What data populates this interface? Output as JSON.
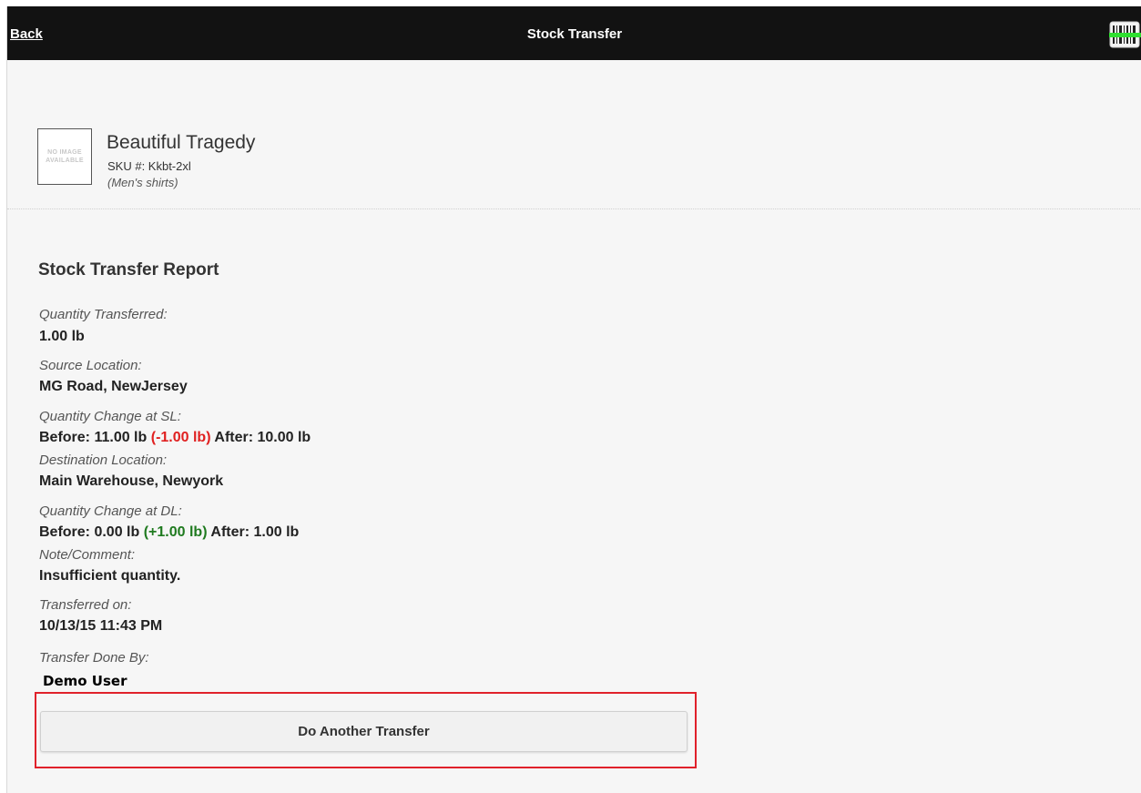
{
  "header": {
    "back_label": "Back",
    "title": "Stock Transfer",
    "barcode_icon": "barcode-scanner-icon"
  },
  "product": {
    "image_placeholder_line1": "NO IMAGE",
    "image_placeholder_line2": "AVAILABLE",
    "name": "Beautiful Tragedy",
    "sku": "SKU #: Kkbt-2xl",
    "category": "(Men's shirts)"
  },
  "report": {
    "title": "Stock Transfer Report",
    "qty_transferred_label": "Quantity Transferred:",
    "qty_transferred_value": "1.00 lb",
    "source_label": "Source Location:",
    "source_value": "MG Road, NewJersey",
    "change_sl_label": "Quantity Change at SL:",
    "change_sl_before": "Before: 11.00 lb",
    "change_sl_delta": "(-1.00 lb)",
    "change_sl_after": "After: 10.00 lb",
    "destination_label": "Destination Location:",
    "destination_value": "Main Warehouse, Newyork",
    "change_dl_label": "Quantity Change at DL:",
    "change_dl_before": "Before: 0.00 lb",
    "change_dl_delta": "(+1.00 lb)",
    "change_dl_after": "After: 1.00 lb",
    "note_label": "Note/Comment:",
    "note_value": "Insufficient quantity.",
    "transferred_on_label": "Transferred on:",
    "transferred_on_value": "10/13/15 11:43 PM",
    "done_by_label": "Transfer Done By:",
    "done_by_value": "Demo User"
  },
  "actions": {
    "another_transfer_label": "Do Another Transfer"
  },
  "colors": {
    "header_bg": "#121212",
    "negative": "#e02020",
    "positive": "#1f7a1f",
    "highlight": "#e0212b"
  }
}
